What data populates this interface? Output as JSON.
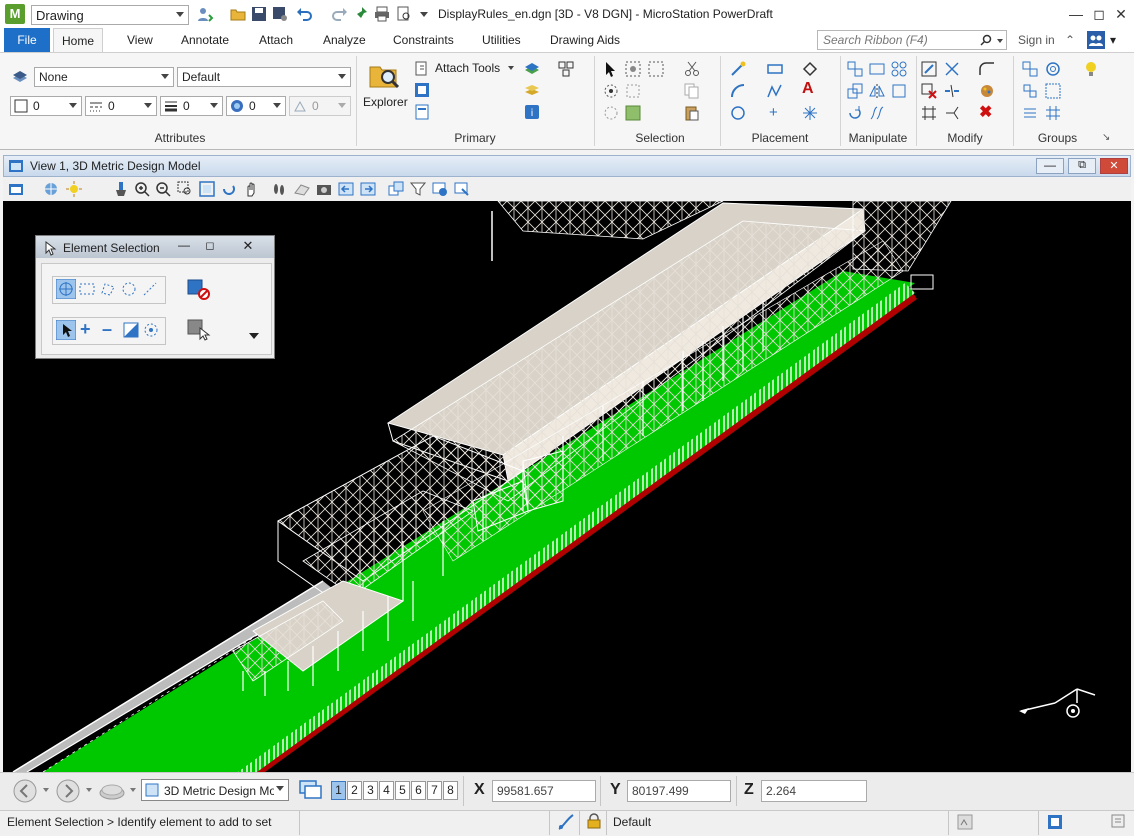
{
  "titlebar": {
    "app_icon": "M",
    "workspace": "Drawing",
    "title": "DisplayRules_en.dgn [3D - V8 DGN] - MicroStation PowerDraft"
  },
  "tabs": [
    "File",
    "Home",
    "View",
    "Annotate",
    "Attach",
    "Analyze",
    "Constraints",
    "Utilities",
    "Drawing Aids"
  ],
  "active_tab": "Home",
  "search": {
    "placeholder": "Search Ribbon (F4)"
  },
  "sign_in": "Sign in",
  "ribbon": {
    "attributes": {
      "level": "None",
      "style_default": "Default",
      "color": "0",
      "weight": "0",
      "linestyle": "0",
      "transparency": "0",
      "priority": "0",
      "label": "Attributes"
    },
    "primary": {
      "explorer": "Explorer",
      "attach_tools": "Attach Tools",
      "label": "Primary"
    },
    "selection_label": "Selection",
    "placement_label": "Placement",
    "manipulate_label": "Manipulate",
    "modify_label": "Modify",
    "groups_label": "Groups"
  },
  "view": {
    "title": "View 1, 3D Metric Design Model",
    "model_combo": "3D Metric Design Mo",
    "view_numbers": [
      "1",
      "2",
      "3",
      "4",
      "5",
      "6",
      "7",
      "8"
    ],
    "active_view": "1"
  },
  "element_selection": {
    "title": "Element Selection"
  },
  "coords": {
    "x_label": "X",
    "x": "99581.657",
    "y_label": "Y",
    "y": "80197.499",
    "z_label": "Z",
    "z": "2.264"
  },
  "status": {
    "prompt": "Element Selection > Identify element to add to set",
    "active_level": "Default"
  },
  "colors": {
    "ribbon_blue": "#1e6fc8",
    "viewport_bg": "#000000",
    "platform_green": "#00c800",
    "edge_red": "#b00000",
    "structure": "#d8d2c8"
  }
}
